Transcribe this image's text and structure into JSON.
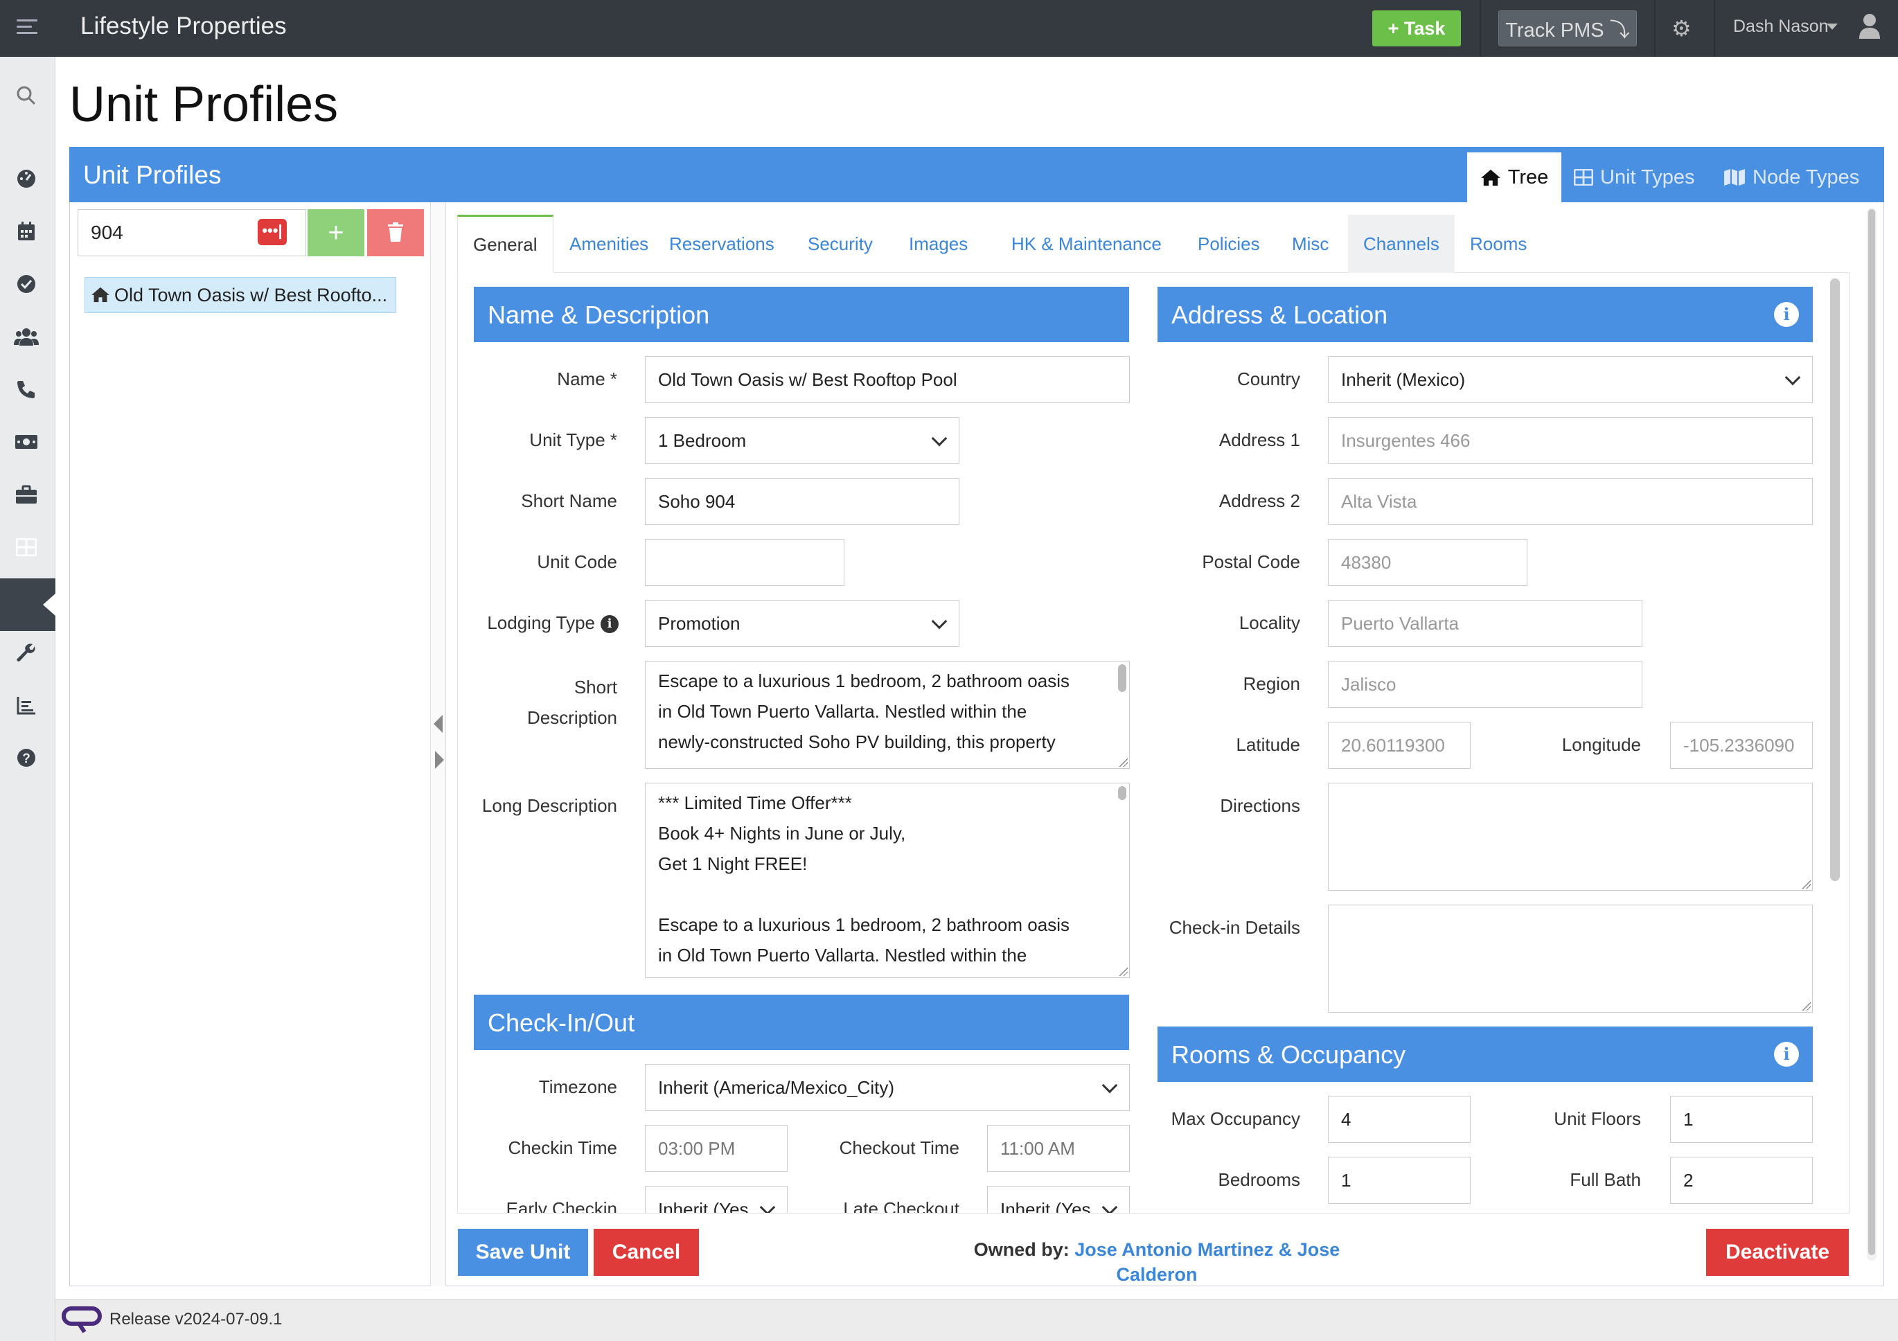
{
  "topbar": {
    "app_title": "Lifestyle Properties",
    "task_label": "+ Task",
    "track_label": "Track PMS ⤵",
    "user_name": "Dash Nason"
  },
  "sidebar": {
    "icons": [
      "search-icon",
      "dashboard-icon",
      "calendar-icon",
      "check-circle-icon",
      "users-icon",
      "phone-icon",
      "money-icon",
      "briefcase-icon",
      "grid-icon",
      "home-icon",
      "wrench-icon",
      "chart-icon",
      "help-icon"
    ],
    "active": "grid-icon"
  },
  "page": {
    "title": "Unit Profiles"
  },
  "panel": {
    "title": "Unit Profiles",
    "tabs": [
      "Tree",
      "Unit Types",
      "Node Types"
    ]
  },
  "tree": {
    "search_value": "904",
    "item_label": "Old Town Oasis w/ Best Roofto..."
  },
  "tabs": [
    "General",
    "Amenities",
    "Reservations",
    "Security",
    "Images",
    "HK & Maintenance",
    "Policies",
    "Misc",
    "Channels",
    "Rooms"
  ],
  "name_desc": {
    "header": "Name & Description",
    "name_label": "Name *",
    "name_value": "Old Town Oasis w/ Best Rooftop Pool",
    "unit_type_label": "Unit Type *",
    "unit_type_value": "1 Bedroom",
    "short_name_label": "Short Name",
    "short_name_value": "Soho 904",
    "unit_code_label": "Unit Code",
    "unit_code_value": "",
    "lodging_type_label": "Lodging Type",
    "lodging_type_value": "Promotion",
    "short_desc_label": "Short\nDescription",
    "short_desc_value": "Escape to a luxurious 1 bedroom, 2 bathroom oasis\nin Old Town Puerto Vallarta. Nestled within the\nnewly-constructed Soho PV building, this property",
    "long_desc_label": "Long Description",
    "long_desc_value": "*** Limited Time Offer***\nBook 4+ Nights in June or July,\nGet 1 Night FREE!\n\nEscape to a luxurious 1 bedroom, 2 bathroom oasis\nin Old Town Puerto Vallarta. Nestled within the"
  },
  "checkinout": {
    "header": "Check-In/Out",
    "timezone_label": "Timezone",
    "timezone_value": "Inherit (America/Mexico_City)",
    "checkin_label": "Checkin Time",
    "checkin_value": "03:00 PM",
    "checkout_label": "Checkout Time",
    "checkout_value": "11:00 AM",
    "early_label": "Early Checkin",
    "early_value": "Inherit (Yes",
    "late_label": "Late Checkout",
    "late_value": "Inherit (Yes"
  },
  "address": {
    "header": "Address & Location",
    "country_label": "Country",
    "country_value": "Inherit (Mexico)",
    "address1_label": "Address 1",
    "address1_placeholder": "Insurgentes 466",
    "address2_label": "Address 2",
    "address2_placeholder": "Alta Vista",
    "postal_label": "Postal Code",
    "postal_placeholder": "48380",
    "locality_label": "Locality",
    "locality_placeholder": "Puerto Vallarta",
    "region_label": "Region",
    "region_placeholder": "Jalisco",
    "latitude_label": "Latitude",
    "latitude_placeholder": "20.60119300",
    "longitude_label": "Longitude",
    "longitude_placeholder": "-105.2336090",
    "directions_label": "Directions",
    "checkin_details_label": "Check-in Details"
  },
  "rooms": {
    "header": "Rooms & Occupancy",
    "max_occ_label": "Max Occupancy",
    "max_occ_value": "4",
    "floors_label": "Unit Floors",
    "floors_value": "1",
    "bedrooms_label": "Bedrooms",
    "bedrooms_value": "1",
    "fullbath_label": "Full Bath",
    "fullbath_value": "2"
  },
  "actions": {
    "save_label": "Save Unit",
    "cancel_label": "Cancel",
    "owned_by_label": "Owned by:",
    "owner_names": "Jose Antonio Martinez & Jose\nCalderon",
    "deactivate_label": "Deactivate"
  },
  "footer": {
    "release": "Release v2024-07-09.1"
  },
  "colors": {
    "primary": "#4a90e2",
    "success": "#6cc04a",
    "danger": "#e03b3b",
    "topbar": "#343a40"
  }
}
